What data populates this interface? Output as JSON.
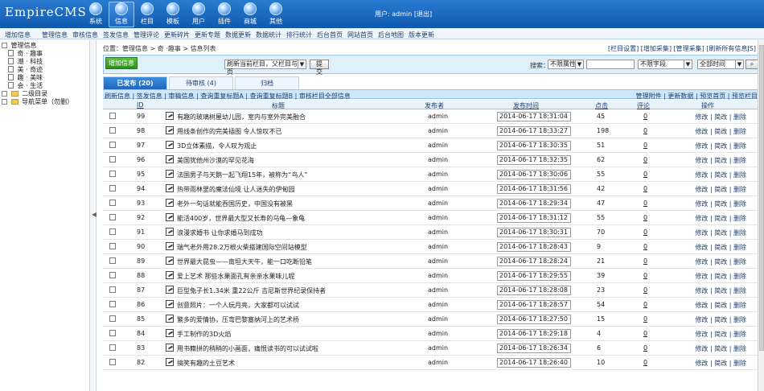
{
  "app": {
    "logo_text": "EmpireCMS",
    "user_prefix": "用户:",
    "user_name": "admin",
    "logout": "[退出]"
  },
  "top_nav": [
    {
      "label": "系统",
      "icon": "system-icon"
    },
    {
      "label": "信息",
      "icon": "info-icon",
      "active": true
    },
    {
      "label": "栏目",
      "icon": "column-icon"
    },
    {
      "label": "模板",
      "icon": "template-icon"
    },
    {
      "label": "用户",
      "icon": "user-icon"
    },
    {
      "label": "插件",
      "icon": "plugin-icon"
    },
    {
      "label": "商城",
      "icon": "shop-icon"
    },
    {
      "label": "其他",
      "icon": "other-icon"
    }
  ],
  "menu": [
    "增加信息",
    "管理信息",
    "审核信息",
    "签发信息",
    "管理评论",
    "更新碎片",
    "更新专题",
    "数据更新",
    "数据统计",
    "排行统计",
    "后台首页",
    "网站首页",
    "后台地图",
    "版本更新"
  ],
  "sidebar": {
    "root": "管理信息",
    "items": [
      {
        "label": "奇 · 趣事"
      },
      {
        "label": "潮 · 科技"
      },
      {
        "label": "美 · 奇迹"
      },
      {
        "label": "趣 · 美味"
      },
      {
        "label": "会 · 生活"
      },
      {
        "label": "二级目录"
      },
      {
        "label": "导航菜单（勿删）"
      }
    ]
  },
  "breadcrumb": "位置：管理信息 > 奇 ·趣事 > 信息列表",
  "right_links": "[栏目设置] [增加采集] [管理采集] [刷新所有信息JS]",
  "panel": {
    "add_button": "增加信息",
    "refresh_select": "刷新当前栏目，父栏目与首页",
    "submit": "提交",
    "search_label": "搜索：",
    "attr_select": "不限属性",
    "field_select": "不限字段",
    "time_select": "全部时间"
  },
  "tabs": [
    {
      "label": "已发布 (20)",
      "active": true
    },
    {
      "label": "待审核 (4)"
    },
    {
      "label": "归档"
    }
  ],
  "toolbar": {
    "left": "刷新信息 | 签发信息 | 审稿信息 | 查询重复标题A | 查询重复标题B | 审核栏目全部信息",
    "right": "管理附件 | 更新数据 | 预览首页 | 预览栏目"
  },
  "table": {
    "headers": [
      "ID",
      "标题",
      "发布者",
      "发布时间",
      "点击",
      "评论",
      "操作"
    ],
    "rows": [
      {
        "id": "99",
        "title": "有趣的玻璃树屋幼儿园，室内与室外完美融合",
        "author": "admin",
        "time": "2014-06-17 18:31:04",
        "clicks": "45",
        "comments": "0",
        "actions": "修改 | 简改 | 删除"
      },
      {
        "id": "98",
        "title": "用线条创作的完美插图 令人惊叹不已",
        "author": "admin",
        "time": "2014-06-17 18:33:27",
        "clicks": "198",
        "comments": "0",
        "actions": "修改 | 简改 | 删除"
      },
      {
        "id": "97",
        "title": "3D立体素描，令人叹为观止",
        "author": "admin",
        "time": "2014-06-17 18:30:35",
        "clicks": "51",
        "comments": "0",
        "actions": "修改 | 简改 | 删除"
      },
      {
        "id": "96",
        "title": "美国犹他州沙漠的罕见花海",
        "author": "admin",
        "time": "2014-06-17 18:32:35",
        "clicks": "62",
        "comments": "0",
        "actions": "修改 | 简改 | 删除"
      },
      {
        "id": "95",
        "title": "法国男子与天鹅一起飞翔15年，被称为“鸟人”",
        "author": "admin",
        "time": "2014-06-17 18:30:06",
        "clicks": "55",
        "comments": "0",
        "actions": "修改 | 简改 | 删除"
      },
      {
        "id": "94",
        "title": "热带雨林里的魔法仙境 让人迷失的伊甸园",
        "author": "admin",
        "time": "2014-06-17 18:31:56",
        "clicks": "42",
        "comments": "0",
        "actions": "修改 | 简改 | 删除"
      },
      {
        "id": "93",
        "title": "老外一句话就能吞国历史，中国没有被黑",
        "author": "admin",
        "time": "2014-06-17 18:29:34",
        "clicks": "47",
        "comments": "0",
        "actions": "修改 | 简改 | 删除"
      },
      {
        "id": "92",
        "title": "能活400岁，世界最大型又长寿的乌龟—象龟",
        "author": "admin",
        "time": "2014-06-17 18:31:12",
        "clicks": "55",
        "comments": "0",
        "actions": "修改 | 简改 | 删除"
      },
      {
        "id": "91",
        "title": "浪漫求婚书 让你求婚马到成功",
        "author": "admin",
        "time": "2014-06-17 18:30:31",
        "clicks": "70",
        "comments": "0",
        "actions": "修改 | 简改 | 删除"
      },
      {
        "id": "90",
        "title": "瑞气老外用28.2万根火柴搭建国际空间站模型",
        "author": "admin",
        "time": "2014-06-17 18:28:43",
        "clicks": "9",
        "comments": "0",
        "actions": "修改 | 简改 | 删除"
      },
      {
        "id": "89",
        "title": "世界最大昆虫——南坦大天牛，能一口吃断铅笔",
        "author": "admin",
        "time": "2014-06-17 18:28:24",
        "clicks": "21",
        "comments": "0",
        "actions": "修改 | 简改 | 删除"
      },
      {
        "id": "88",
        "title": "爱上艺术 那些水果面孔有亲亲水果味儿呢",
        "author": "admin",
        "time": "2014-06-17 18:29:55",
        "clicks": "39",
        "comments": "0",
        "actions": "修改 | 简改 | 删除"
      },
      {
        "id": "87",
        "title": "巨型兔子长1.34米 重22公斤 吉尼斯世界纪录保持者",
        "author": "admin",
        "time": "2014-06-17 18:28:08",
        "clicks": "23",
        "comments": "0",
        "actions": "修改 | 简改 | 删除"
      },
      {
        "id": "86",
        "title": "创意照片：一个人玩月亮，大家都可以试试",
        "author": "admin",
        "time": "2014-06-17 18:28:57",
        "clicks": "54",
        "comments": "0",
        "actions": "修改 | 简改 | 删除"
      },
      {
        "id": "85",
        "title": "繁多的爱情协，压弯巴黎塞纳河上的艺术桥",
        "author": "admin",
        "time": "2014-06-17 18:27:50",
        "clicks": "15",
        "comments": "0",
        "actions": "修改 | 简改 | 删除"
      },
      {
        "id": "84",
        "title": "手工制作的3D火焰",
        "author": "admin",
        "time": "2014-06-17 18:29:18",
        "clicks": "4",
        "comments": "0",
        "actions": "修改 | 简改 | 删除"
      },
      {
        "id": "83",
        "title": "用书籍拼的稍稍的小画面，痛恨读书的可以试试啦",
        "author": "admin",
        "time": "2014-06-17 18:26:34",
        "clicks": "6",
        "comments": "0",
        "actions": "修改 | 简改 | 删除"
      },
      {
        "id": "82",
        "title": "搞笑有趣的土豆艺术",
        "author": "admin",
        "time": "2014-06-17 18:26:40",
        "clicks": "10",
        "comments": "0",
        "actions": "修改 | 简改 | 删除"
      }
    ]
  }
}
